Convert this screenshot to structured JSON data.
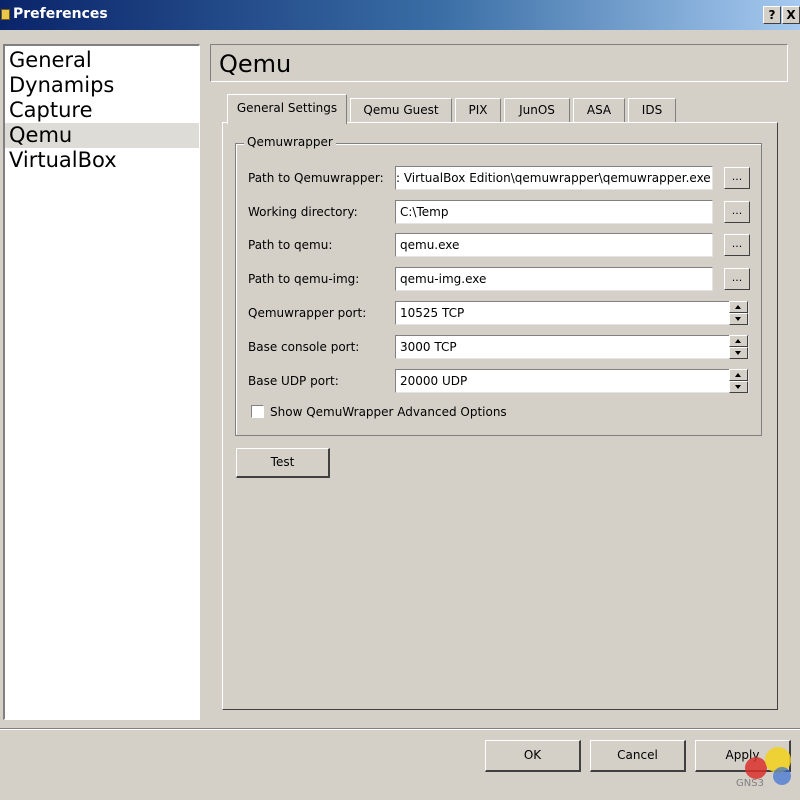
{
  "window": {
    "title": "Preferences",
    "help_label": "?",
    "close_label": "X"
  },
  "sidebar": {
    "items": [
      {
        "label": "General"
      },
      {
        "label": "Dynamips"
      },
      {
        "label": "Capture"
      },
      {
        "label": "Qemu",
        "selected": true
      },
      {
        "label": "VirtualBox"
      }
    ]
  },
  "header": {
    "title": "Qemu"
  },
  "tabs": [
    {
      "label": "General Settings",
      "active": true
    },
    {
      "label": "Qemu Guest"
    },
    {
      "label": "PIX"
    },
    {
      "label": "JunOS"
    },
    {
      "label": "ASA"
    },
    {
      "label": "IDS"
    }
  ],
  "group": {
    "title": "Qemuwrapper",
    "fields": [
      {
        "label": "Path to Qemuwrapper:",
        "value": ": VirtualBox Edition\\qemuwrapper\\qemuwrapper.exe",
        "control": "browse"
      },
      {
        "label": "Working directory:",
        "value": "C:\\Temp",
        "control": "browse"
      },
      {
        "label": "Path to qemu:",
        "value": "qemu.exe",
        "control": "browse"
      },
      {
        "label": "Path to qemu-img:",
        "value": "qemu-img.exe",
        "control": "browse"
      },
      {
        "label": "Qemuwrapper port:",
        "value": "10525 TCP",
        "control": "spin"
      },
      {
        "label": "Base console port:",
        "value": "3000 TCP",
        "control": "spin"
      },
      {
        "label": "Base UDP port:",
        "value": "20000 UDP",
        "control": "spin"
      }
    ],
    "browse_label": "...",
    "advanced_checkbox": {
      "label": "Show QemuWrapper Advanced Options",
      "checked": false
    }
  },
  "test_button": "Test",
  "footer": {
    "ok": "OK",
    "cancel": "Cancel",
    "apply": "Apply"
  },
  "watermark": "GNS3",
  "colors": {
    "titlebar_start": "#0a246a",
    "titlebar_end": "#a6caf0",
    "face": "#d4d0c8",
    "selection": "#dedcd6"
  }
}
